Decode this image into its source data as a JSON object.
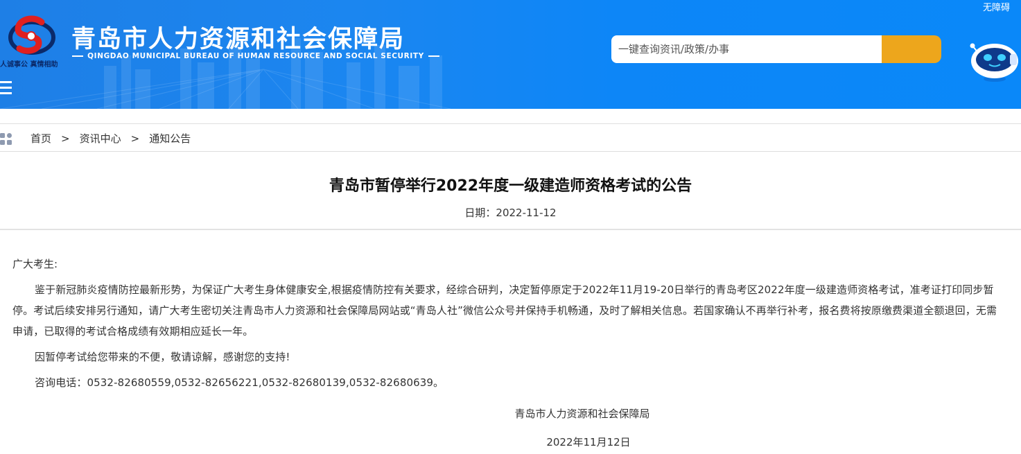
{
  "header": {
    "accessibility_link": "无障碍",
    "logo_slogan": "人诚事公  真情相助",
    "title": "青岛市人力资源和社会保障局",
    "subtitle": "QINGDAO MUNICIPAL BUREAU OF HUMAN RESOURCE AND SOCIAL SECURITY",
    "search_placeholder": "一键查询资讯/政策/办事",
    "search_value": ""
  },
  "breadcrumb": {
    "items": [
      "首页",
      "资讯中心",
      "通知公告"
    ],
    "separator": ">"
  },
  "article": {
    "title": "青岛市暂停举行2022年度一级建造师资格考试的公告",
    "date_label": "日期：",
    "date": "2022-11-12",
    "greeting": "广大考生:",
    "paragraph1": "鉴于新冠肺炎疫情防控最新形势，为保证广大考生身体健康安全,根据疫情防控有关要求，经综合研判，决定暂停原定于2022年11月19-20日举行的青岛考区2022年度一级建造师资格考试，准考证打印同步暂停。考试后续安排另行通知，请广大考生密切关注青岛市人力资源和社会保障局网站或“青岛人社”微信公众号并保持手机畅通，及时了解相关信息。若国家确认不再举行补考，报名费将按原缴费渠道全额退回，无需申请，已取得的考试合格成绩有效期相应延长一年。",
    "paragraph2": "因暂停考试给您带来的不便，敬请谅解，感谢您的支持!",
    "paragraph3": "咨询电话：0532-82680559,0532-82656221,0532-82680139,0532-82680639。",
    "signature_org": "青岛市人力资源和社会保障局",
    "signature_date": "2022年11月12日"
  },
  "colors": {
    "header_blue": "#0a88f9",
    "search_button": "#eda61c",
    "logo_red": "#e02020",
    "logo_navy": "#0b2a6a"
  },
  "icons": {
    "logo": "bureau-emblem-icon",
    "menu": "hamburger-menu-icon",
    "search": "search-button",
    "robot": "assistant-robot-icon",
    "breadcrumb": "grid-icon"
  }
}
